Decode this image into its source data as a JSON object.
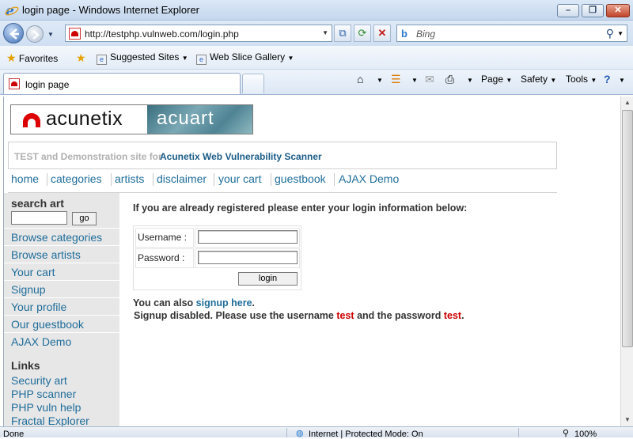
{
  "window": {
    "title": "login page - Windows Internet Explorer",
    "minimize": "–",
    "maximize": "❐",
    "close": "✕"
  },
  "addressbar": {
    "url": "http://testphp.vulnweb.com/login.php",
    "search_placeholder": "Bing"
  },
  "favorites_bar": {
    "favorites": "Favorites",
    "suggested_sites": "Suggested Sites",
    "web_slice_gallery": "Web Slice Gallery"
  },
  "tabs": [
    {
      "label": "login page"
    }
  ],
  "command_bar": {
    "page": "Page",
    "safety": "Safety",
    "tools": "Tools"
  },
  "site": {
    "logo_left": "acunetix",
    "logo_right": "acuart",
    "tagline_grey": "TEST and Demonstration site for",
    "tagline_blue": "Acunetix Web Vulnerability Scanner",
    "nav": [
      "home",
      "categories",
      "artists",
      "disclaimer",
      "your cart",
      "guestbook",
      "AJAX Demo"
    ],
    "sidebar": {
      "search_heading": "search art",
      "go_label": "go",
      "links": [
        "Browse categories",
        "Browse artists",
        "Your cart",
        "Signup",
        "Your profile",
        "Our guestbook",
        "AJAX Demo"
      ],
      "links_heading": "Links",
      "external_links": [
        "Security art",
        "PHP scanner",
        "PHP vuln help",
        "Fractal Explorer"
      ]
    },
    "login": {
      "intro": "If you are already registered please enter your login information below:",
      "username_label": "Username :",
      "password_label": "Password :",
      "username_value": "",
      "password_value": "",
      "submit_label": "login",
      "signup_prefix": "You can also",
      "signup_link": "signup here",
      "signup_suffix": ".",
      "disabled_prefix": "Signup disabled. Please use the username",
      "disabled_username": "test",
      "disabled_mid": "and the password",
      "disabled_password": "test",
      "disabled_suffix": "."
    }
  },
  "statusbar": {
    "status": "Done",
    "zone": "Internet | Protected Mode: On",
    "zoom": "100%"
  }
}
